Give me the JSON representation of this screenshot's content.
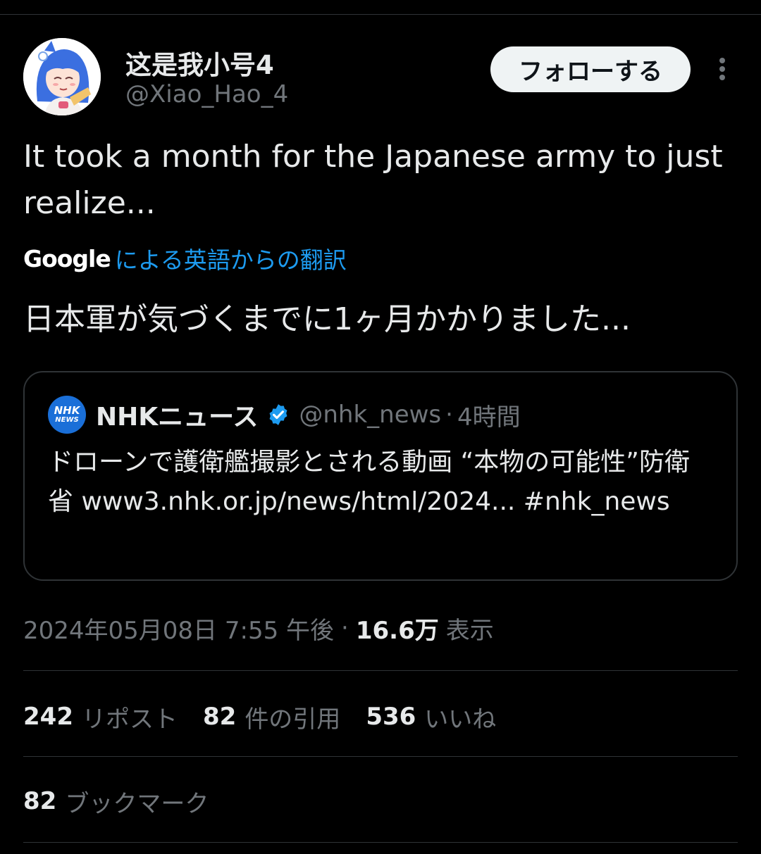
{
  "author": {
    "display_name": "这是我小号4",
    "handle": "@Xiao_Hao_4",
    "avatar_icon": "anime-girl-avatar"
  },
  "actions": {
    "follow_label": "フォローする",
    "more_icon": "more-vertical-icon"
  },
  "tweet": {
    "text": "It took a month for the Japanese army to just realize...",
    "translation_brand": "Google",
    "translation_link": "による英語からの翻訳",
    "translated_text": "日本軍が気づくまでに1ヶ月かかりました..."
  },
  "quote": {
    "logo_text_top": "NHK",
    "logo_text_bottom": "NEWS",
    "name": "NHKニュース",
    "verified_icon": "verified-badge-icon",
    "handle": "@nhk_news",
    "separator": "·",
    "time": "4時間",
    "body": "ドローンで護衛艦撮影とされる動画 “本物の可能性”防衛省 www3.nhk.or.jp/news/html/2024... #nhk_news"
  },
  "meta": {
    "datetime": "2024年05月08日 7:55 午後",
    "separator": "·",
    "views_count": "16.6万",
    "views_label": "表示"
  },
  "stats": [
    {
      "count": "242",
      "label": "リポスト"
    },
    {
      "count": "82",
      "label": "件の引用"
    },
    {
      "count": "536",
      "label": "いいね"
    }
  ],
  "bookmarks": {
    "count": "82",
    "label": "ブックマーク"
  },
  "colors": {
    "background": "#000000",
    "text": "#e7e9ea",
    "muted": "#71767b",
    "link": "#1d9bf0",
    "divider": "#2f3336",
    "verified": "#1d9bf0"
  }
}
